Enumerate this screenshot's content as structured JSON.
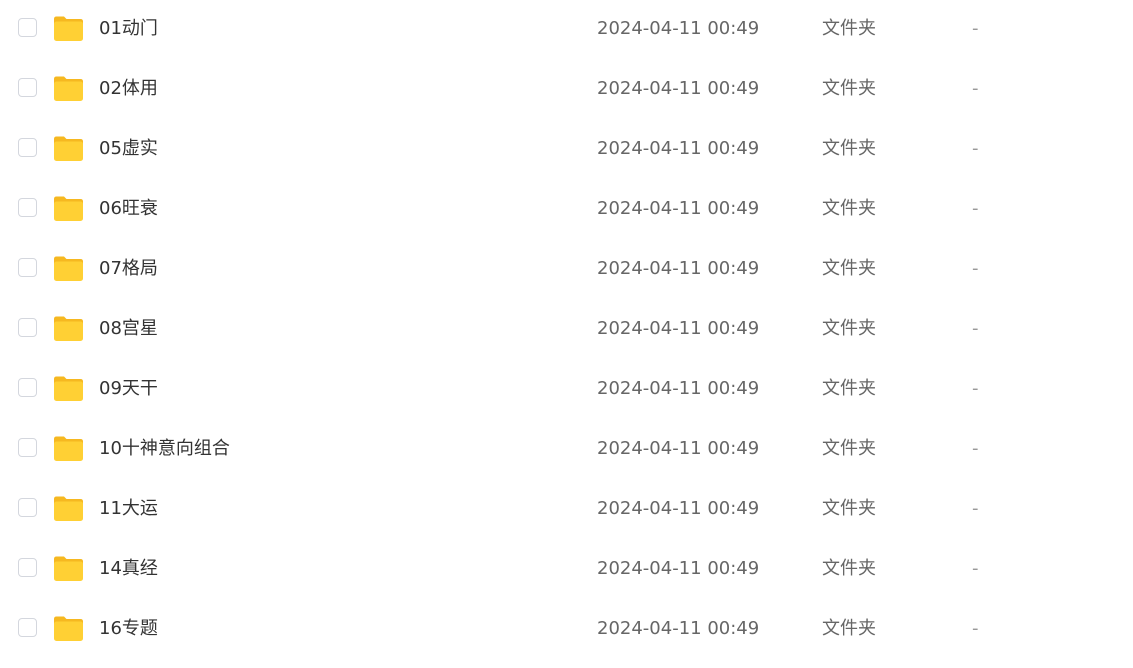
{
  "file_list": {
    "rows": [
      {
        "name": "01动门",
        "modified": "2024-04-11 00:49",
        "type": "文件夹",
        "size": "-",
        "icon": "folder-icon"
      },
      {
        "name": "02体用",
        "modified": "2024-04-11 00:49",
        "type": "文件夹",
        "size": "-",
        "icon": "folder-icon"
      },
      {
        "name": "05虚实",
        "modified": "2024-04-11 00:49",
        "type": "文件夹",
        "size": "-",
        "icon": "folder-icon"
      },
      {
        "name": "06旺衰",
        "modified": "2024-04-11 00:49",
        "type": "文件夹",
        "size": "-",
        "icon": "folder-icon"
      },
      {
        "name": "07格局",
        "modified": "2024-04-11 00:49",
        "type": "文件夹",
        "size": "-",
        "icon": "folder-icon"
      },
      {
        "name": "08宫星",
        "modified": "2024-04-11 00:49",
        "type": "文件夹",
        "size": "-",
        "icon": "folder-icon"
      },
      {
        "name": "09天干",
        "modified": "2024-04-11 00:49",
        "type": "文件夹",
        "size": "-",
        "icon": "folder-icon"
      },
      {
        "name": "10十神意向组合",
        "modified": "2024-04-11 00:49",
        "type": "文件夹",
        "size": "-",
        "icon": "folder-icon"
      },
      {
        "name": "11大运",
        "modified": "2024-04-11 00:49",
        "type": "文件夹",
        "size": "-",
        "icon": "folder-icon"
      },
      {
        "name": "14真经",
        "modified": "2024-04-11 00:49",
        "type": "文件夹",
        "size": "-",
        "icon": "folder-icon"
      },
      {
        "name": "16专题",
        "modified": "2024-04-11 00:49",
        "type": "文件夹",
        "size": "-",
        "icon": "folder-icon"
      }
    ]
  },
  "colors": {
    "folder_body": "#ffd034",
    "folder_back": "#f6b820",
    "checkbox_border": "#d4d7de",
    "name_text": "#333333",
    "meta_text": "#666666"
  }
}
